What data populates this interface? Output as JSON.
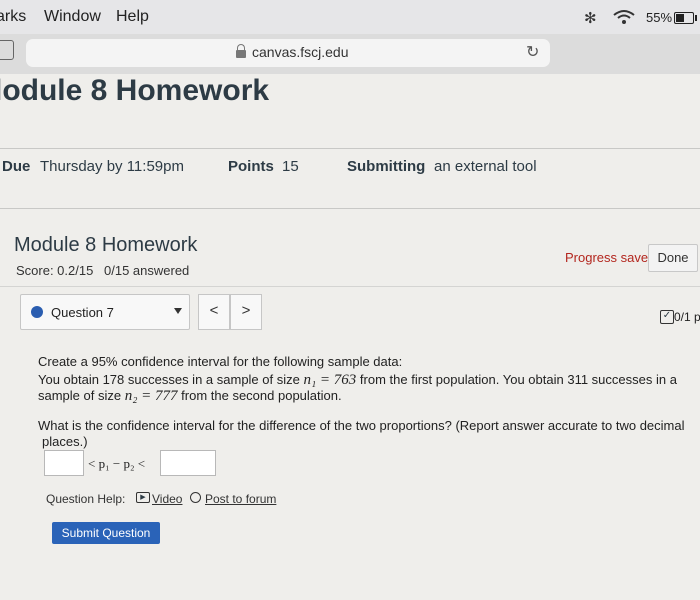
{
  "menubar": {
    "items": [
      "arks",
      "Window",
      "Help"
    ],
    "battery_percent": "55%",
    "battery_level": 0.55
  },
  "browser": {
    "url": "canvas.fscj.edu"
  },
  "page": {
    "title": "lodule 8 Homework",
    "due_label": "Due",
    "due_value": "Thursday by 11:59pm",
    "points_label": "Points",
    "points_value": "15",
    "submitting_label": "Submitting",
    "submitting_value": "an external tool"
  },
  "module": {
    "title": "Module 8 Homework",
    "score": "Score: 0.2/15",
    "answered": "0/15 answered",
    "progress_saved": "Progress saved",
    "done_label": "Done"
  },
  "question_nav": {
    "selected": "Question 7",
    "prev": "<",
    "next": ">",
    "points": "0/1 p"
  },
  "question": {
    "line1": "Create a 95% confidence interval for the following sample data:",
    "line2_a": "You obtain 178 successes in a sample of size ",
    "n1_expr": "n₁ = 763",
    "line2_b": " from the first population. You obtain 311 successes in a",
    "line3_a": "sample of size ",
    "n2_expr": "n₂ = 777",
    "line3_b": " from the second population.",
    "line4": "What is the confidence interval for the difference of the two proportions? (Report answer accurate to two decimal",
    "line5": "places.)",
    "between_expr": "< p₁ − p₂ <",
    "lower_value": "",
    "upper_value": ""
  },
  "help": {
    "label": "Question Help:",
    "video": "Video",
    "forum": "Post to forum"
  },
  "submit_label": "Submit Question"
}
